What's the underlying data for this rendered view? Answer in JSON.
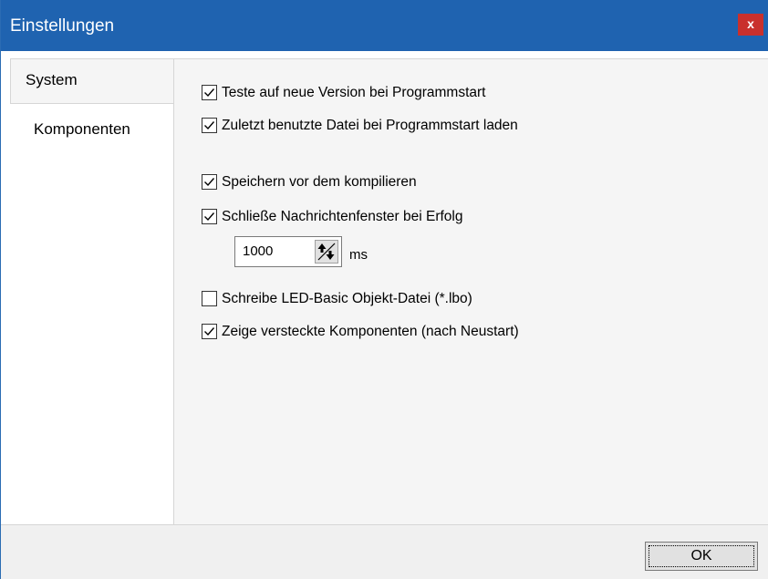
{
  "window": {
    "title": "Einstellungen",
    "close_label": "x"
  },
  "tabs": [
    {
      "label": "System",
      "active": true
    },
    {
      "label": "Komponenten",
      "active": false
    }
  ],
  "options": [
    {
      "label": "Teste auf neue Version bei Programmstart",
      "checked": true
    },
    {
      "label": "Zuletzt benutzte Datei bei Programmstart laden",
      "checked": true
    },
    {
      "label": "Speichern vor dem kompilieren",
      "checked": true
    },
    {
      "label": "Schließe Nachrichtenfenster bei Erfolg",
      "checked": true
    },
    {
      "label": "Schreibe LED-Basic Objekt-Datei (*.lbo)",
      "checked": false
    },
    {
      "label": "Zeige versteckte Komponenten (nach Neustart)",
      "checked": true
    }
  ],
  "timeout": {
    "value": "1000",
    "unit": "ms"
  },
  "footer": {
    "ok_label": "OK"
  },
  "colors": {
    "titlebar": "#1f63b0",
    "close": "#c9302c",
    "panel": "#f5f5f5"
  }
}
